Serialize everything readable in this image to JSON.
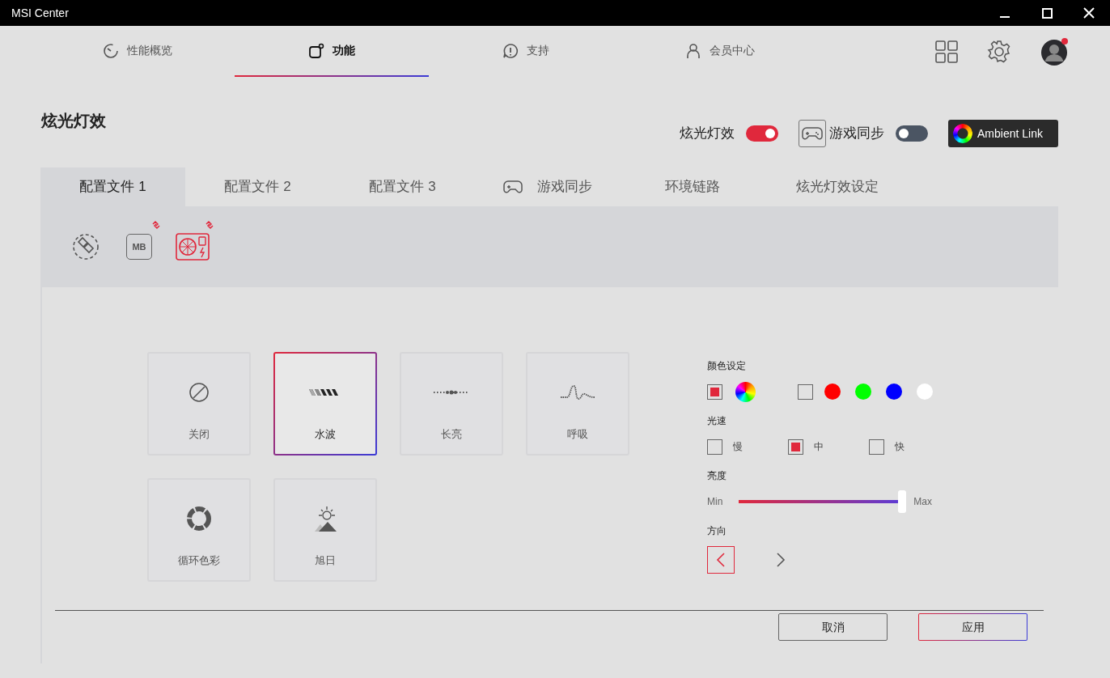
{
  "window": {
    "title": "MSI Center"
  },
  "nav": {
    "items": [
      {
        "label": "性能概览",
        "kind": "gauge",
        "selected": false
      },
      {
        "label": "功能",
        "kind": "feature",
        "selected": true
      },
      {
        "label": "支持",
        "kind": "support",
        "selected": false
      },
      {
        "label": "会员中心",
        "kind": "member",
        "selected": false
      }
    ],
    "avatar": {
      "notification": true
    }
  },
  "header": {
    "title": "炫光灯效",
    "toggles": [
      {
        "label": "炫光灯效",
        "kind": "plain",
        "on": true
      },
      {
        "label": "游戏同步",
        "kind": "gamepad",
        "on": false
      }
    ],
    "ambient_link_button": {
      "label": "Ambient Link"
    }
  },
  "tabs": [
    {
      "label": "配置文件 1",
      "kind": "text",
      "selected": true
    },
    {
      "label": "配置文件 2",
      "kind": "text",
      "selected": false
    },
    {
      "label": "配置文件 3",
      "kind": "text",
      "selected": false
    },
    {
      "label": "游戏同步",
      "kind": "gamepad",
      "selected": false
    },
    {
      "label": "环境链路",
      "kind": "text",
      "selected": false
    },
    {
      "label": "炫光灯效设定",
      "kind": "text",
      "selected": false
    }
  ],
  "devices": [
    {
      "kind": "sync",
      "selected": false
    },
    {
      "kind": "motherboard",
      "label": "MB",
      "selected": false,
      "linked": true
    },
    {
      "kind": "graphics-card",
      "selected": true,
      "linked": true
    }
  ],
  "effects": [
    {
      "label": "关闭",
      "kind": "off",
      "selected": false
    },
    {
      "label": "水波",
      "kind": "wave",
      "selected": true
    },
    {
      "label": "长亮",
      "kind": "steady",
      "selected": false
    },
    {
      "label": "呼吸",
      "kind": "breathing",
      "selected": false
    },
    {
      "label": "循环色彩",
      "kind": "cycle",
      "selected": false
    },
    {
      "label": "旭日",
      "kind": "sunrise",
      "selected": false
    }
  ],
  "color_settings": {
    "label": "颜色设定",
    "modes": [
      {
        "kind": "rainbow",
        "checked": true
      },
      {
        "kind": "custom",
        "checked": false,
        "swatches": [
          {
            "color": "#ff0000"
          },
          {
            "color": "#00ff00"
          },
          {
            "color": "#0000ff"
          },
          {
            "color": "#ffffff"
          }
        ]
      }
    ]
  },
  "speed": {
    "label": "光速",
    "options": [
      {
        "label": "慢",
        "checked": false
      },
      {
        "label": "中",
        "checked": true
      },
      {
        "label": "快",
        "checked": false
      }
    ]
  },
  "brightness": {
    "label": "亮度",
    "min_label": "Min",
    "max_label": "Max",
    "level": 1
  },
  "direction": {
    "label": "方向",
    "options": [
      {
        "kind": "left",
        "selected": true
      },
      {
        "kind": "right",
        "selected": false
      }
    ]
  },
  "footer": {
    "buttons": [
      {
        "label": "取消",
        "kind": "secondary"
      },
      {
        "label": "应用",
        "kind": "primary"
      }
    ]
  }
}
